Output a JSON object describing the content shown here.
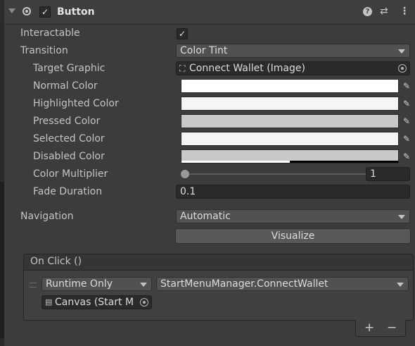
{
  "header": {
    "title": "Button",
    "enabled": true,
    "icons": [
      "foldout-arrow-icon",
      "component-icon",
      "help-icon",
      "presets-icon",
      "kebab-menu-icon"
    ]
  },
  "fields": {
    "interactable": {
      "label": "Interactable",
      "checked": true
    },
    "transition": {
      "label": "Transition",
      "value": "Color Tint"
    },
    "target_graphic": {
      "label": "Target Graphic",
      "value": "Connect Wallet (Image)"
    },
    "normal_color": {
      "label": "Normal Color",
      "color": "#ffffff"
    },
    "highlighted_color": {
      "label": "Highlighted Color",
      "color": "#f5f5f5"
    },
    "pressed_color": {
      "label": "Pressed Color",
      "color": "#c8c8c8"
    },
    "selected_color": {
      "label": "Selected Color",
      "color": "#f5f5f5"
    },
    "disabled_color": {
      "label": "Disabled Color",
      "color": "#c8c8c8",
      "alpha": 0.5
    },
    "color_multiplier": {
      "label": "Color Multiplier",
      "value": "1",
      "slider_fraction": 0
    },
    "fade_duration": {
      "label": "Fade Duration",
      "value": "0.1"
    },
    "navigation": {
      "label": "Navigation",
      "value": "Automatic",
      "visualize_label": "Visualize"
    }
  },
  "on_click": {
    "title": "On Click ()",
    "runtime": "Runtime Only",
    "function": "StartMenuManager.ConnectWallet",
    "object": "Canvas (Start M",
    "add_label": "+",
    "remove_label": "−"
  }
}
